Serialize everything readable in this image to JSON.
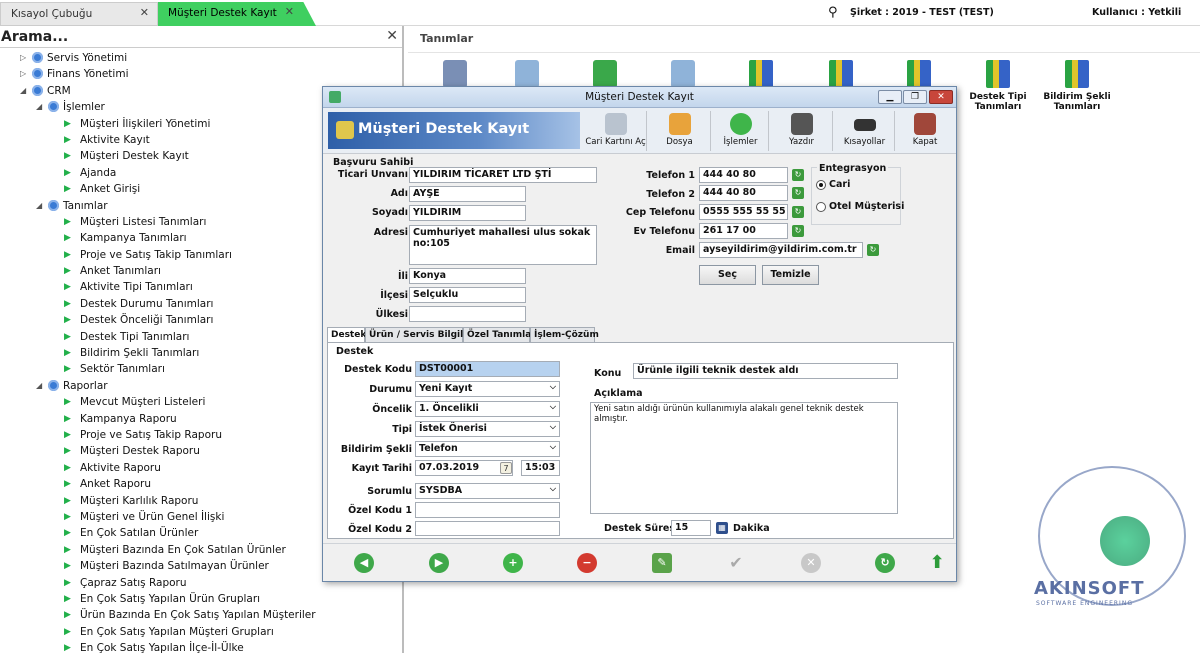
{
  "topbar": {
    "tab_shortcuts": "Kısayol Çubuğu",
    "tab_active": "Müşteri Destek Kayıt",
    "company": "Şirket : 2019 - TEST (TEST)",
    "user": "Kullanıcı : Yetkili"
  },
  "sidebar": {
    "title": "Arama...",
    "items": [
      {
        "label": "Servis Yönetimi",
        "level": 0,
        "kind": "group",
        "exp": "▷"
      },
      {
        "label": "Finans Yönetimi",
        "level": 0,
        "kind": "group",
        "exp": "▷"
      },
      {
        "label": "CRM",
        "level": 0,
        "kind": "group",
        "exp": "◢"
      },
      {
        "label": "İşlemler",
        "level": 1,
        "kind": "group",
        "exp": "◢"
      },
      {
        "label": "Müşteri İlişkileri Yönetimi",
        "level": 2,
        "kind": "leaf"
      },
      {
        "label": "Aktivite Kayıt",
        "level": 2,
        "kind": "leaf"
      },
      {
        "label": "Müşteri Destek Kayıt",
        "level": 2,
        "kind": "leaf"
      },
      {
        "label": "Ajanda",
        "level": 2,
        "kind": "leaf"
      },
      {
        "label": "Anket Girişi",
        "level": 2,
        "kind": "leaf"
      },
      {
        "label": "Tanımlar",
        "level": 1,
        "kind": "group",
        "exp": "◢"
      },
      {
        "label": "Müşteri Listesi Tanımları",
        "level": 2,
        "kind": "leaf"
      },
      {
        "label": "Kampanya Tanımları",
        "level": 2,
        "kind": "leaf"
      },
      {
        "label": "Proje ve Satış Takip Tanımları",
        "level": 2,
        "kind": "leaf"
      },
      {
        "label": "Anket Tanımları",
        "level": 2,
        "kind": "leaf"
      },
      {
        "label": "Aktivite Tipi Tanımları",
        "level": 2,
        "kind": "leaf"
      },
      {
        "label": "Destek Durumu Tanımları",
        "level": 2,
        "kind": "leaf"
      },
      {
        "label": "Destek Önceliği Tanımları",
        "level": 2,
        "kind": "leaf"
      },
      {
        "label": "Destek Tipi Tanımları",
        "level": 2,
        "kind": "leaf"
      },
      {
        "label": "Bildirim Şekli Tanımları",
        "level": 2,
        "kind": "leaf"
      },
      {
        "label": "Sektör Tanımları",
        "level": 2,
        "kind": "leaf"
      },
      {
        "label": "Raporlar",
        "level": 1,
        "kind": "group",
        "exp": "◢"
      },
      {
        "label": "Mevcut Müşteri Listeleri",
        "level": 2,
        "kind": "leaf"
      },
      {
        "label": "Kampanya Raporu",
        "level": 2,
        "kind": "leaf"
      },
      {
        "label": "Proje ve Satış Takip Raporu",
        "level": 2,
        "kind": "leaf"
      },
      {
        "label": "Müşteri Destek Raporu",
        "level": 2,
        "kind": "leaf"
      },
      {
        "label": "Aktivite Raporu",
        "level": 2,
        "kind": "leaf"
      },
      {
        "label": "Anket Raporu",
        "level": 2,
        "kind": "leaf"
      },
      {
        "label": "Müşteri Karlılık Raporu",
        "level": 2,
        "kind": "leaf"
      },
      {
        "label": "Müşteri ve Ürün Genel İlişki",
        "level": 2,
        "kind": "leaf"
      },
      {
        "label": "En Çok Satılan Ürünler",
        "level": 2,
        "kind": "leaf"
      },
      {
        "label": "Müşteri Bazında En Çok Satılan Ürünler",
        "level": 2,
        "kind": "leaf"
      },
      {
        "label": "Müşteri Bazında Satılmayan Ürünler",
        "level": 2,
        "kind": "leaf"
      },
      {
        "label": "Çapraz Satış Raporu",
        "level": 2,
        "kind": "leaf"
      },
      {
        "label": "En Çok Satış Yapılan Ürün Grupları",
        "level": 2,
        "kind": "leaf"
      },
      {
        "label": "Ürün Bazında En Çok Satış Yapılan Müşteriler",
        "level": 2,
        "kind": "leaf"
      },
      {
        "label": "En Çok Satış Yapılan Müşteri Grupları",
        "level": 2,
        "kind": "leaf"
      },
      {
        "label": "En Çok Satış Yapılan İlçe-İl-Ülke",
        "level": 2,
        "kind": "leaf"
      }
    ]
  },
  "main": {
    "title": "Tanımlar",
    "tools": [
      {
        "label": "",
        "icon": "users-icon"
      },
      {
        "label": "",
        "icon": "card-icon"
      },
      {
        "label": "",
        "icon": "cube-icon"
      },
      {
        "label": "",
        "icon": "doc-icon"
      },
      {
        "label": "",
        "icon": "book-icon"
      },
      {
        "label": "",
        "icon": "book-icon"
      },
      {
        "label": "",
        "icon": "book-icon"
      },
      {
        "label": "Destek Tipi Tanımları",
        "icon": "book-icon"
      },
      {
        "label": "Bildirim Şekli Tanımları",
        "icon": "book-icon"
      }
    ]
  },
  "dialog": {
    "title": "Müşteri Destek Kayıt",
    "header": "Müşteri Destek Kayıt",
    "toolbar": [
      "Cari Kartını Aç",
      "Dosya",
      "İşlemler",
      "Yazdır",
      "Kısayollar",
      "Kapat"
    ],
    "section": "Başvuru Sahibi",
    "fields": {
      "ticari_label": "Ticari Unvanı",
      "ticari": "YILDIRIM TİCARET LTD ŞTİ",
      "adi_label": "Adı",
      "adi": "AYŞE",
      "soyadi_label": "Soyadı",
      "soyadi": "YILDIRIM",
      "adres_label": "Adresi",
      "adres": "Cumhuriyet mahallesi ulus sokak no:105",
      "il_label": "İli",
      "il": "Konya",
      "ilce_label": "İlçesi",
      "ilce": "Selçuklu",
      "ulke_label": "Ülkesi",
      "ulke": "",
      "tel1_label": "Telefon 1",
      "tel1": "444 40 80",
      "tel2_label": "Telefon 2",
      "tel2": "444 40 80",
      "cep_label": "Cep Telefonu",
      "cep": "0555 555 55 55",
      "ev_label": "Ev Telefonu",
      "ev": "261 17 00",
      "email_label": "Email",
      "email": "ayseyildirim@yildirim.com.tr"
    },
    "entegrasyon": {
      "title": "Entegrasyon",
      "opt1": "Cari",
      "opt2": "Otel Müşterisi"
    },
    "sec_button": "Seç",
    "temizle_button": "Temizle",
    "tabs": [
      "Destek",
      "Ürün / Servis Bilgileri",
      "Özel Tanımlar",
      "İşlem-Çözüm"
    ],
    "destek": {
      "title": "Destek",
      "kod_label": "Destek Kodu",
      "kod": "DST00001",
      "durum_label": "Durumu",
      "durum": "Yeni Kayıt",
      "oncelik_label": "Öncelik",
      "oncelik": "1. Öncelikli",
      "tip_label": "Tipi",
      "tip": "İstek Önerisi",
      "bildirim_label": "Bildirim Şekli",
      "bildirim": "Telefon",
      "tarih_label": "Kayıt Tarihi",
      "tarih": "07.03.2019",
      "saat": "15:03",
      "sorumlu_label": "Sorumlu",
      "sorumlu": "SYSDBA",
      "ozel1_label": "Özel Kodu 1",
      "ozel1": "",
      "ozel2_label": "Özel Kodu 2",
      "ozel2": "",
      "konu_label": "Konu",
      "konu": "Ürünle ilgili teknik destek aldı",
      "aciklama_label": "Açıklama",
      "aciklama": "Yeni satın aldığı ürünün kullanımıyla alakalı genel teknik destek almıştır.",
      "sure_label": "Destek Süresi",
      "sure": "15",
      "sure_unit": "Dakika"
    }
  },
  "logo": {
    "brand": "AKINSOFT",
    "sub": "SOFTWARE ENGINEERING"
  }
}
